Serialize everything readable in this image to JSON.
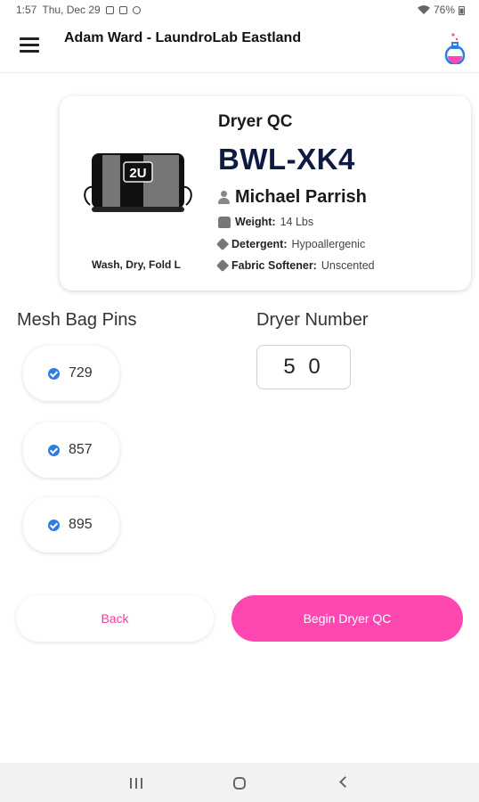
{
  "status_bar": {
    "time": "1:57",
    "date": "Thu, Dec 29",
    "battery": "76%"
  },
  "app_bar": {
    "title": "Adam Ward - LaundroLab Eastland",
    "menu_icon": "hamburger-menu-icon",
    "logo_icon": "flask-logo-icon"
  },
  "card": {
    "title": "Dryer QC",
    "bag_code": "BWL-XK4",
    "bag_label": "2U",
    "customer": "Michael Parrish",
    "service": "Wash, Dry, Fold L",
    "weight_label": "Weight:",
    "weight_value": "14 Lbs",
    "detergent_label": "Detergent:",
    "detergent_value": "Hypoallergenic",
    "softener_label": "Fabric Softener:",
    "softener_value": "Unscented"
  },
  "pins": {
    "label": "Mesh Bag Pins",
    "items": [
      "729",
      "857",
      "895"
    ]
  },
  "dryer": {
    "label": "Dryer Number",
    "value": "5 0"
  },
  "buttons": {
    "back": "Back",
    "begin": "Begin Dryer QC"
  },
  "colors": {
    "accent": "#ff47b2",
    "back_text": "#ee3c9c",
    "check": "#2a7de1",
    "code": "#0e1a44"
  }
}
